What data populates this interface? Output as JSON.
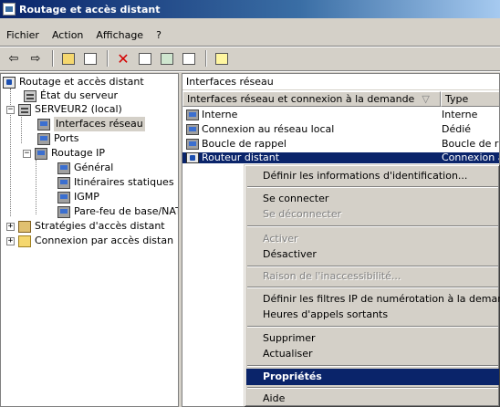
{
  "window": {
    "title": "Routage et accès distant"
  },
  "menu": [
    "Fichier",
    "Action",
    "Affichage",
    "?"
  ],
  "toolbar": {
    "icons": [
      "back-arrow-icon",
      "forward-arrow-icon",
      "up-folder-icon",
      "show-hide-tree-icon",
      "delete-icon",
      "properties-icon",
      "refresh-icon",
      "export-list-icon",
      "help-icon"
    ]
  },
  "tree": {
    "root": "Routage et accès distant",
    "server_status": "État du serveur",
    "server": "SERVEUR2 (local)",
    "interfaces": "Interfaces réseau",
    "ports": "Ports",
    "ip_routing": "Routage IP",
    "general": "Général",
    "static_routes": "Itinéraires statiques",
    "igmp": "IGMP",
    "nat": "Pare-feu de base/NAT",
    "policies": "Stratégies d'accès distant",
    "dial_in": "Connexion par accès distan"
  },
  "panel": {
    "title": "Interfaces réseau",
    "col_name": "Interfaces réseau et connexion à la demande",
    "col_type": "Type",
    "sort_glyph": "▽",
    "rows": [
      {
        "name": "Interne",
        "type": "Interne"
      },
      {
        "name": "Connexion au réseau local",
        "type": "Dédié"
      },
      {
        "name": "Boucle de rappel",
        "type": "Boucle de rap"
      },
      {
        "name": "Routeur distant",
        "type": "Connexion à"
      }
    ]
  },
  "context_menu": {
    "set_credentials": "Définir les informations d'identification...",
    "connect": "Se connecter",
    "disconnect": "Se déconnecter",
    "enable": "Activer",
    "disable": "Désactiver",
    "unreachability": "Raison de l'inaccessibilité...",
    "ip_filters": "Définir les filtres IP de numérotation à la demande",
    "dial_hours": "Heures d'appels sortants",
    "delete": "Supprimer",
    "refresh": "Actualiser",
    "properties": "Propriétés",
    "help": "Aide"
  }
}
